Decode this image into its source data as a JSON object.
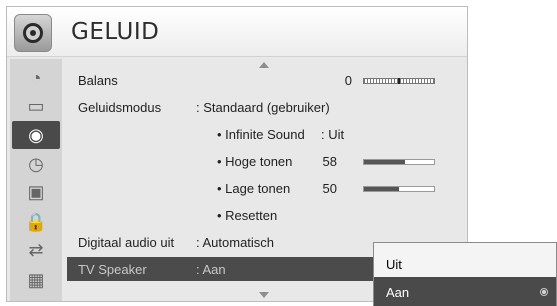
{
  "header": {
    "title": "GELUID",
    "icon": "speaker-icon"
  },
  "sidebar": {
    "items": [
      {
        "name": "picture-icon",
        "glyph": "◔"
      },
      {
        "name": "monitor-icon",
        "glyph": "▭"
      },
      {
        "name": "sound-icon",
        "glyph": "◉",
        "active": true
      },
      {
        "name": "clock-icon",
        "glyph": "◷"
      },
      {
        "name": "briefcase-icon",
        "glyph": "▣"
      },
      {
        "name": "lock-icon",
        "glyph": "🔒"
      },
      {
        "name": "cable-icon",
        "glyph": "⇄"
      },
      {
        "name": "photo-icon",
        "glyph": "▦"
      }
    ]
  },
  "menu": {
    "balance": {
      "label": "Balans",
      "value": "0",
      "position": 0.5
    },
    "sound_mode": {
      "label": "Geluidsmodus",
      "value": ": Standaard (gebruiker)"
    },
    "infinite_sound": {
      "label": "• Infinite Sound",
      "value": ": Uit"
    },
    "treble": {
      "label": "• Hoge tonen",
      "value": "58",
      "level": 0.58
    },
    "bass": {
      "label": "• Lage tonen",
      "value": "50",
      "level": 0.5
    },
    "reset": {
      "label": "• Resetten"
    },
    "digital_audio": {
      "label": "Digitaal audio uit",
      "value": ": Automatisch"
    },
    "tv_speaker": {
      "label": "TV Speaker",
      "value": ": Aan"
    }
  },
  "popup": {
    "options": [
      {
        "label": "Uit",
        "selected": false
      },
      {
        "label": "Aan",
        "selected": true
      }
    ]
  }
}
